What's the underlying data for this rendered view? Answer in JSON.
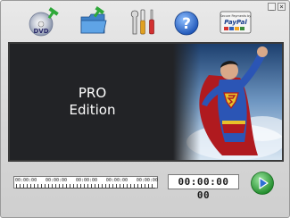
{
  "window": {
    "minimize_glyph": "_",
    "close_glyph": "×"
  },
  "toolbar": {
    "buttons": [
      {
        "name": "dvd-add",
        "icon": "dvd-arrow-icon",
        "disc_label": "DVD"
      },
      {
        "name": "open-folder",
        "icon": "folder-arrow-icon"
      },
      {
        "name": "settings",
        "icon": "tools-icon"
      },
      {
        "name": "help",
        "icon": "help-icon",
        "glyph": "?"
      },
      {
        "name": "buy",
        "icon": "paypal-secure-payment-icon",
        "small_text": "Secure Payments by",
        "brand": "PayPal"
      }
    ]
  },
  "viewer": {
    "edition_line1": "PRO",
    "edition_line2": "Edition",
    "background_color": "#222326"
  },
  "timeline": {
    "labels": [
      "00:00:00",
      "00:00:00",
      "00:00:00",
      "00:00:00",
      "00:00:00"
    ]
  },
  "clock": {
    "time": "00:00:00 00"
  },
  "colors": {
    "accent_green": "#2fa83a",
    "accent_blue": "#2e6fd6",
    "frame": "#3a3a3a"
  }
}
